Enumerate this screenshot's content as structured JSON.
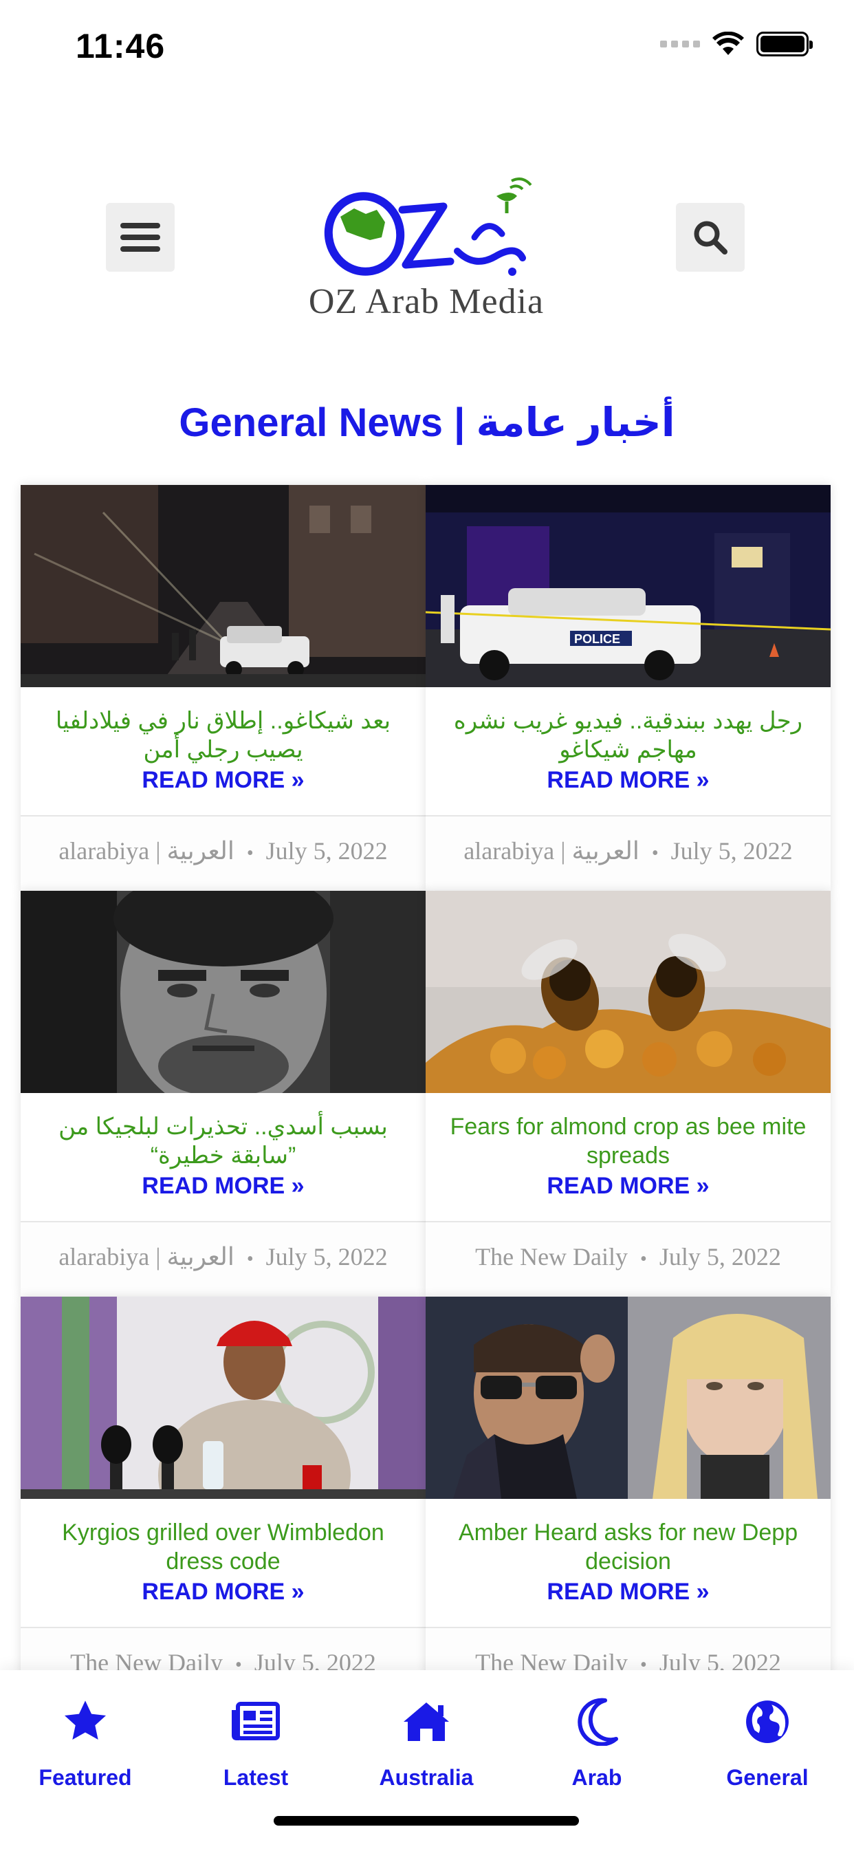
{
  "status": {
    "time": "11:46"
  },
  "header": {
    "logo_text": "OZ Arab Media",
    "logo_mark": "OZ عرب",
    "menu_icon": "hamburger-menu-icon",
    "search_icon": "search-icon"
  },
  "section": {
    "title": "General News | أخبار عامة"
  },
  "cards": [
    {
      "title": "بعد شيكاغو.. إطلاق نار في فيلادلفيا يصيب رجلي أمن",
      "read_more": "READ MORE »",
      "source": "alarabiya | العربية",
      "date": "July 5, 2022"
    },
    {
      "title": "رجل يهدد ببندقية.. فيديو غريب نشره مهاجم شيكاغو",
      "read_more": "READ MORE »",
      "source": "alarabiya | العربية",
      "date": "July 5, 2022"
    },
    {
      "title": "بسبب أسدي.. تحذيرات لبلجيكا من ”سابقة خطيرة“",
      "read_more": "READ MORE »",
      "source": "alarabiya | العربية",
      "date": "July 5, 2022"
    },
    {
      "title": "Fears for almond crop as bee mite spreads",
      "read_more": "READ MORE »",
      "source": "The New Daily",
      "date": "July 5, 2022"
    },
    {
      "title": "Kyrgios grilled over Wimbledon dress code",
      "read_more": "READ MORE »",
      "source": "The New Daily",
      "date": "July 5, 2022"
    },
    {
      "title": "Amber Heard asks for new Depp decision",
      "read_more": "READ MORE »",
      "source": "The New Daily",
      "date": "July 5, 2022"
    }
  ],
  "nav": {
    "items": [
      {
        "label": "Featured",
        "icon": "star-icon"
      },
      {
        "label": "Latest",
        "icon": "newspaper-icon"
      },
      {
        "label": "Australia",
        "icon": "home-icon"
      },
      {
        "label": "Arab",
        "icon": "moon-icon"
      },
      {
        "label": "General",
        "icon": "globe-icon"
      }
    ]
  },
  "colors": {
    "accent_blue": "#1a1ae6",
    "title_green": "#3c9a1c",
    "meta_gray": "#9a9a9a"
  }
}
